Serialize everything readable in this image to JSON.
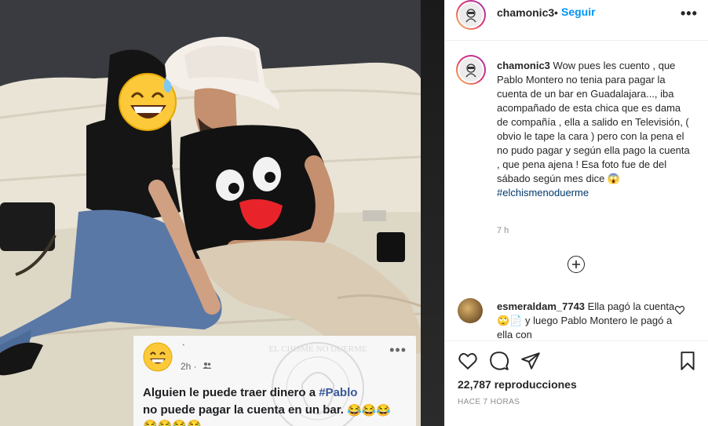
{
  "post": {
    "username": "chamonic3",
    "dot": "•",
    "follow_label": "Seguir",
    "more_icon": "more-horizontal-icon",
    "more_label": "•••"
  },
  "caption": {
    "username": "chamonic3",
    "text": "Wow pues les cuento , que Pablo Montero no tenia para pagar la cuenta de un bar en Guadalajara..., iba acompañado de esta chica que es dama de compañía , ella a salido en Televisión, ( obvio le tape la cara ) pero con la pena el no pudo pagar y según ella pago la cuenta , que pena ajena ! Esa foto fue de del sábado según mes dice 😱",
    "hashtag": "#elchismenoduerme",
    "time": "7 h"
  },
  "load_more_icon": "plus-circle-icon",
  "comment": {
    "username": "esmeraldam_7743",
    "text": "Ella pagó la cuenta 🙄📄 y luego Pablo Montero le pagó a ella con",
    "like_icon": "heart-outline-icon"
  },
  "actions": {
    "like_icon": "heart-icon",
    "comment_icon": "comment-icon",
    "share_icon": "paper-plane-icon",
    "save_icon": "bookmark-icon"
  },
  "views": {
    "count": "22,787",
    "label": "reproducciones"
  },
  "date": "HACE 7 HORAS",
  "media": {
    "fb_name": "`",
    "fb_time": "2h ·",
    "fb_line1_pre": "Alguien le puede traer dinero a ",
    "fb_hashtag": "#Pablo",
    "fb_line2": "no puede pagar la cuenta en un bar.",
    "fb_emojis_line2": "😂😂😂",
    "fb_emojis_line3": "😂😂😂😂",
    "fb_dots": "•••",
    "watermark_text": "EL CHISME NO DUERME"
  },
  "colors": {
    "accent": "#0095f6",
    "hashtag": "#00376b",
    "muted": "#8e8e8e",
    "text": "#262626"
  }
}
